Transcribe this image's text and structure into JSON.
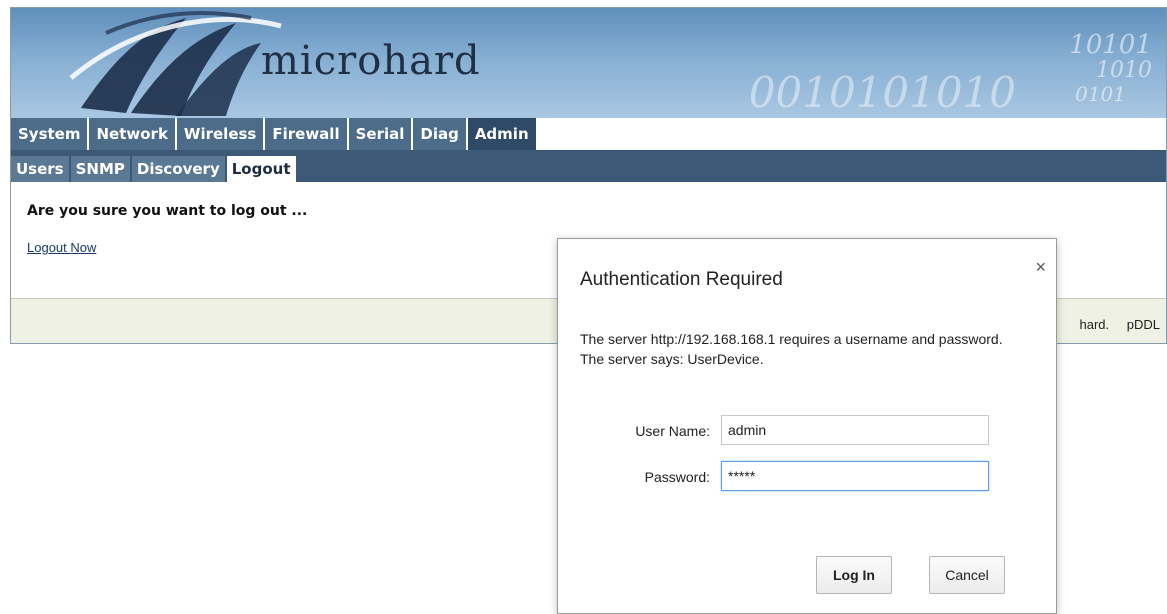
{
  "banner": {
    "brand": "microhard",
    "binary_line1": "10101",
    "binary_line2": "1010",
    "binary_line3": "0101",
    "binary_line4": "0010101010"
  },
  "nav": {
    "main_tabs": [
      "System",
      "Network",
      "Wireless",
      "Firewall",
      "Serial",
      "Diag",
      "Admin"
    ],
    "active_main": "Admin",
    "sub_tabs": [
      "Users",
      "SNMP",
      "Discovery",
      "Logout"
    ],
    "active_sub": "Logout"
  },
  "content": {
    "question": "Are you sure you want to log out ...",
    "logout_link": "Logout Now"
  },
  "footer": {
    "text": "hard. pDDL"
  },
  "dialog": {
    "title": "Authentication Required",
    "close": "×",
    "message": "The server http://192.168.168.1 requires a username and password. The server says: UserDevice.",
    "username_label": "User Name:",
    "username_value": "admin",
    "password_label": "Password:",
    "password_value": "*****",
    "login_button": "Log In",
    "cancel_button": "Cancel"
  },
  "colors": {
    "nav_tab": "#4c6c8a",
    "nav_active": "#2e4a66",
    "subbar": "#3c5a78",
    "footer_bg": "#eef1e3",
    "focus_border": "#5b9ee6"
  }
}
